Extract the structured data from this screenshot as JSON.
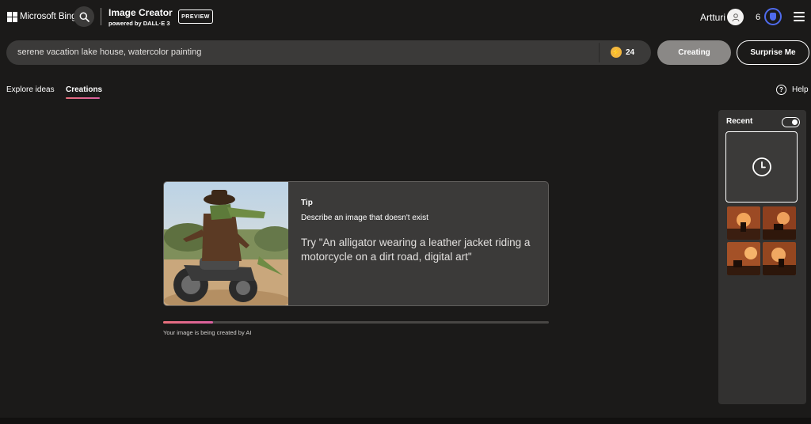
{
  "header": {
    "brand": "Microsoft Bing",
    "app_title": "Image Creator",
    "app_subtitle": "powered by DALL·E 3",
    "badge": "PREVIEW",
    "user_name": "Artturi",
    "rewards_count": "6"
  },
  "prompt": {
    "value": "serene vacation lake house, watercolor painting",
    "boosts": "24",
    "creating_label": "Creating",
    "surprise_label": "Surprise Me"
  },
  "tabs": [
    {
      "label": "Explore ideas",
      "active": false
    },
    {
      "label": "Creations",
      "active": true
    }
  ],
  "help": {
    "label": "Help"
  },
  "tip": {
    "heading": "Tip",
    "description": "Describe an image that doesn't exist",
    "example": "Try \"An alligator wearing a leather jacket riding a motorcycle on a dirt road, digital art\""
  },
  "progress": {
    "label": "Your image is being created by AI",
    "fraction": 0.13
  },
  "recent": {
    "title": "Recent",
    "toggle_on": true
  },
  "colors": {
    "background": "#1b1a19",
    "surface": "#3b3a39",
    "accent_gradient_start": "#e8707b",
    "accent_gradient_end": "#d95fa0",
    "boost": "#f4b73e",
    "rewards": "#4f6bed"
  },
  "icons": [
    "search-icon",
    "user-avatar-icon",
    "rewards-medal-icon",
    "menu-icon",
    "boost-icon",
    "help-icon",
    "clock-icon"
  ]
}
